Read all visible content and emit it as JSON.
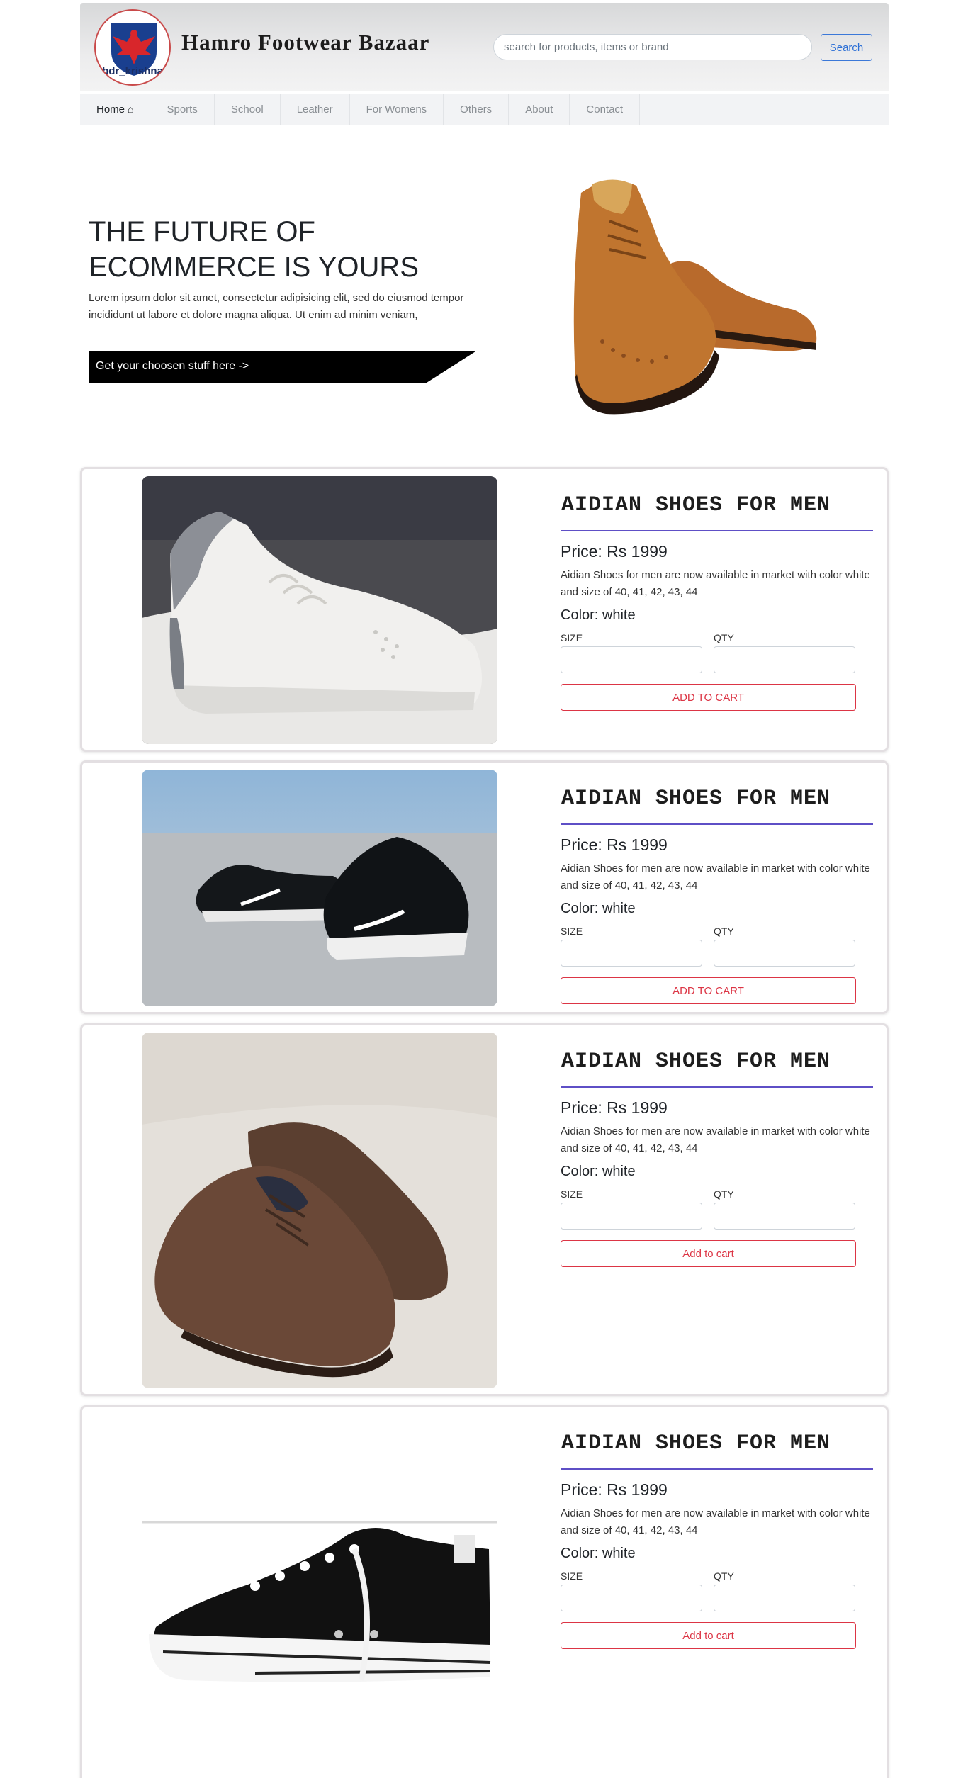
{
  "header": {
    "logo_text": "bdr_krishna",
    "brand": "Hamro Footwear Bazaar",
    "search_placeholder": "search for products, items or brand",
    "search_button": "Search"
  },
  "nav": {
    "items": [
      "Home",
      "Sports",
      "School",
      "Leather",
      "For Womens",
      "Others",
      "About",
      "Contact"
    ]
  },
  "hero": {
    "title_line1": "THE FUTURE OF",
    "title_line2": "ECOMMERCE IS YOURS",
    "text": "Lorem ipsum dolor sit amet, consectetur adipisicing elit, sed do eiusmod tempor incididunt ut labore et dolore magna aliqua. Ut enim ad minim veniam,",
    "cta": "Get your choosen stuff here ->"
  },
  "products": [
    {
      "title": "AIDIAN SHOES FOR MEN",
      "price": "Price: Rs 1999",
      "description": "Aidian Shoes for men are now available in market with color white and size of 40, 41, 42, 43, 44",
      "color": "Color: white",
      "size_label": "SIZE",
      "qty_label": "QTY",
      "button": "ADD TO CART"
    },
    {
      "title": "AIDIAN SHOES FOR MEN",
      "price": "Price: Rs 1999",
      "description": "Aidian Shoes for men are now available in market with color white and size of 40, 41, 42, 43, 44",
      "color": "Color: white",
      "size_label": "SIZE",
      "qty_label": "QTY",
      "button": "ADD TO CART"
    },
    {
      "title": "AIDIAN SHOES FOR MEN",
      "price": "Price: Rs 1999",
      "description": "Aidian Shoes for men are now available in market with color white and size of 40, 41, 42, 43, 44",
      "color": "Color: white",
      "size_label": "SIZE",
      "qty_label": "QTY",
      "button": "Add to cart"
    },
    {
      "title": "AIDIAN SHOES FOR MEN",
      "price": "Price: Rs 1999",
      "description": "Aidian Shoes for men are now available in market with color white and size of 40, 41, 42, 43, 44",
      "color": "Color: white",
      "size_label": "SIZE",
      "qty_label": "QTY",
      "button": "Add to cart"
    }
  ],
  "colors": {
    "accent_red": "#dc3545",
    "title_underline": "#5e4fc6",
    "search_blue": "#2c6fd6"
  },
  "icons": {
    "home": "home-icon",
    "logo": "eagle-logo-icon"
  }
}
